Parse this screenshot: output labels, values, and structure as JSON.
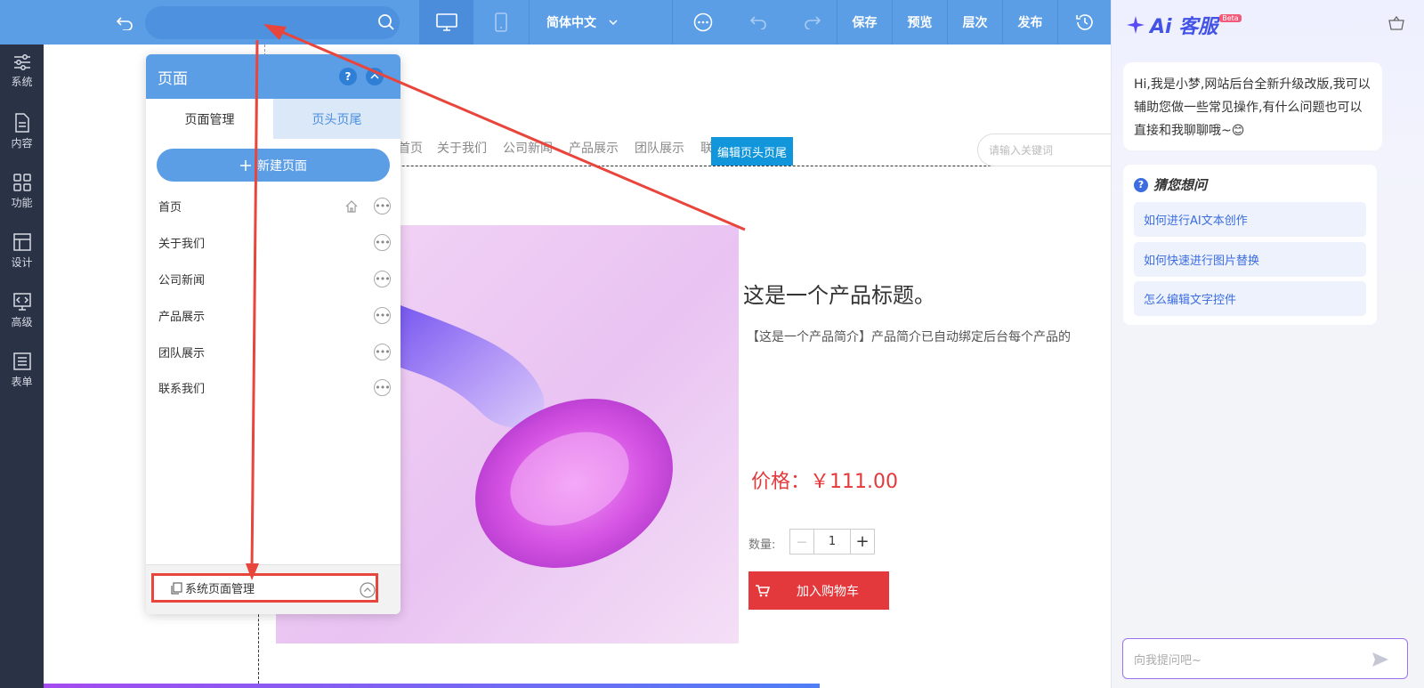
{
  "toolbar": {
    "language": "简体中文",
    "save": "保存",
    "preview": "预览",
    "layers": "层次",
    "publish": "发布"
  },
  "sidebar": {
    "items": [
      {
        "label": "系统",
        "icon": "sliders-icon"
      },
      {
        "label": "内容",
        "icon": "document-icon"
      },
      {
        "label": "功能",
        "icon": "grid-icon"
      },
      {
        "label": "设计",
        "icon": "layout-icon"
      },
      {
        "label": "高级",
        "icon": "code-icon"
      },
      {
        "label": "表单",
        "icon": "form-icon"
      }
    ]
  },
  "site": {
    "nav": [
      "首页",
      "关于我们",
      "公司新闻",
      "产品展示",
      "团队展示",
      "联"
    ],
    "edit_header_footer": "编辑页头页尾",
    "search_placeholder": "请输入关键词"
  },
  "product": {
    "title": "这是一个产品标题。",
    "intro": "【这是一个产品简介】产品简介已自动绑定后台每个产品的",
    "price": "价格：￥111.00",
    "qty_label": "数量:",
    "qty_value": "1",
    "minus": "—",
    "plus": "+",
    "add_to_cart": "加入购物车"
  },
  "page_panel": {
    "title": "页面",
    "help": "?",
    "tabs": [
      "页面管理",
      "页头页尾"
    ],
    "new_page": "新建页面",
    "pages": [
      "首页",
      "关于我们",
      "公司新闻",
      "产品展示",
      "团队展示",
      "联系我们"
    ],
    "system_pages": "系统页面管理"
  },
  "chat": {
    "title": "Ai 客服",
    "beta": "Beta",
    "greeting": "Hi,我是小梦,网站后台全新升级改版,我可以辅助您做一些常见操作,有什么问题也可以直接和我聊聊哦~😊",
    "suggest_title": "猜您想问",
    "suggestions": [
      "如何进行AI文本创作",
      "如何快速进行图片替换",
      "怎么编辑文字控件"
    ],
    "input_placeholder": "向我提问吧~"
  },
  "colors": {
    "topbar": "#5b9ee6",
    "sidebar": "#2a3246",
    "price_red": "#e4393c",
    "cart_red": "#e4393c",
    "edit_teal": "#1296db",
    "annotation_red": "#e8453c"
  }
}
